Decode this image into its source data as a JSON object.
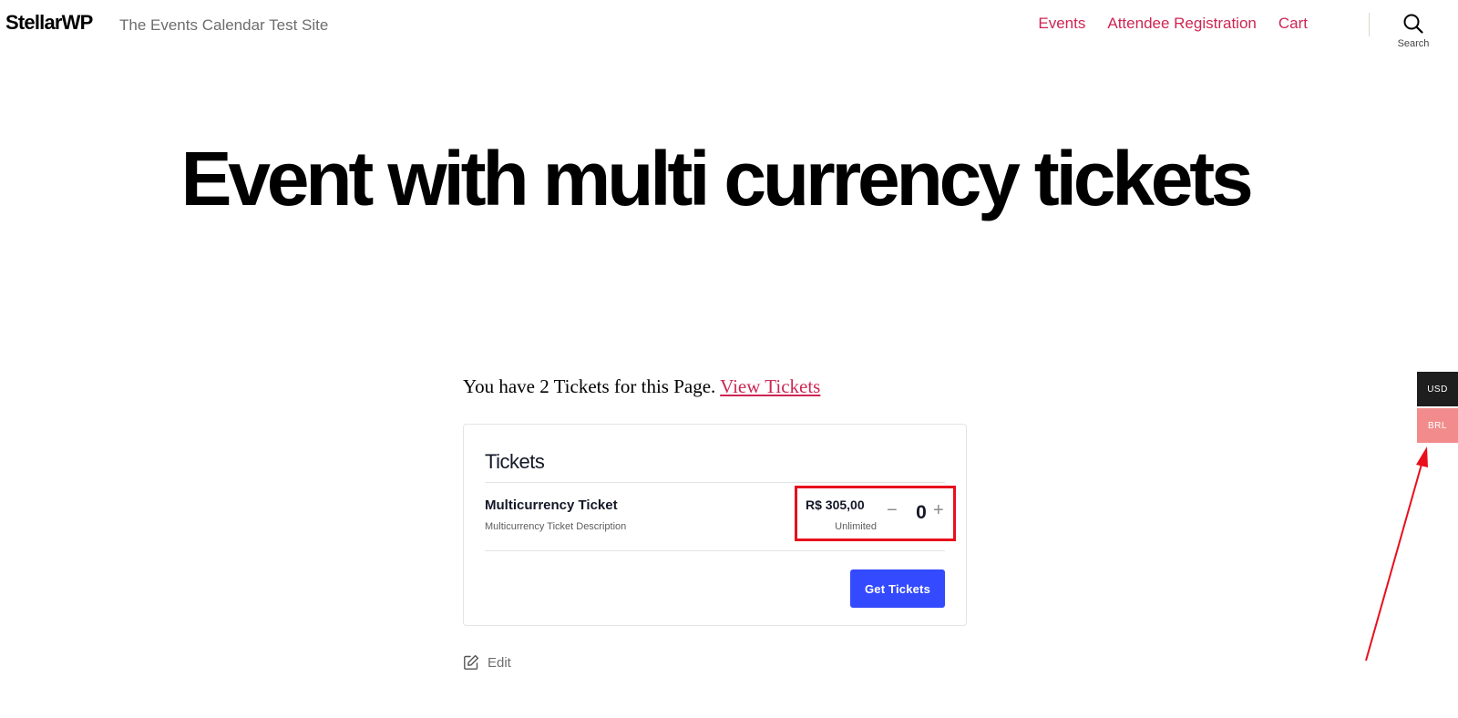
{
  "header": {
    "logo": "StellarWP",
    "site_description": "The Events Calendar Test Site",
    "nav": [
      "Events",
      "Attendee Registration",
      "Cart"
    ],
    "search_label": "Search"
  },
  "entry": {
    "title": "Event with multi currency tickets"
  },
  "notice": {
    "text": "You have 2 Tickets for this Page. ",
    "link": "View Tickets"
  },
  "tickets": {
    "title": "Tickets",
    "item": {
      "name": "Multicurrency Ticket",
      "description": "Multicurrency Ticket Description",
      "price": "R$ 305,00",
      "availability": "Unlimited",
      "quantity": "0",
      "minus": "−",
      "plus": "+"
    },
    "submit_label": "Get Tickets"
  },
  "edit": {
    "label": "Edit"
  },
  "currency_switcher": {
    "options": [
      "USD",
      "BRL"
    ],
    "selected": "BRL"
  },
  "annotation_colors": {
    "highlight": "#e8101c",
    "accent": "#cd2653",
    "button": "#334aff"
  }
}
